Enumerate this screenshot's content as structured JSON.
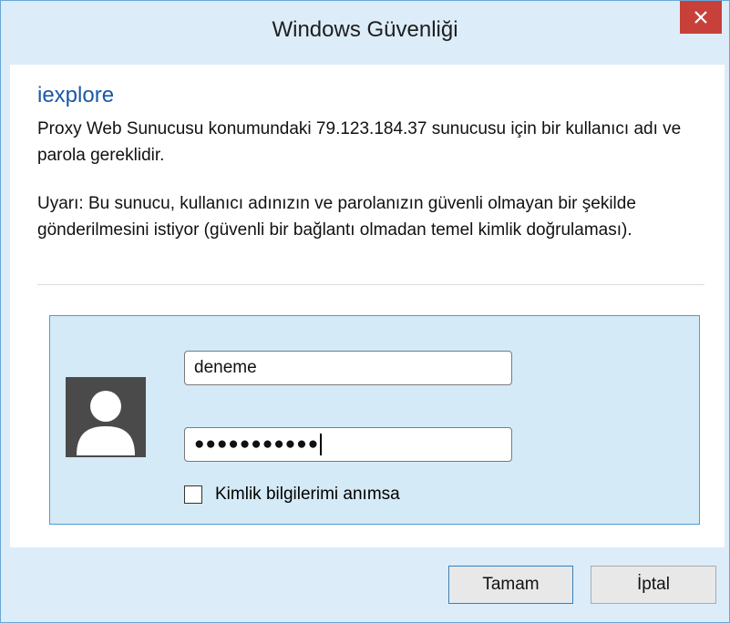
{
  "window": {
    "title": "Windows Güvenliği",
    "close_icon": "close-icon"
  },
  "dialog": {
    "app_name": "iexplore",
    "message": "Proxy Web Sunucusu konumundaki 79.123.184.37 sunucusu için bir kullanıcı adı ve parola gereklidir.",
    "warning": "Uyarı: Bu sunucu, kullanıcı adınızın ve parolanızın güvenli olmayan bir şekilde gönderilmesini istiyor (güvenli bir bağlantı olmadan temel kimlik doğrulaması)."
  },
  "credentials": {
    "avatar_icon": "user-avatar-icon",
    "username_value": "deneme",
    "password_value": "●●●●●●●●●●●",
    "remember_label": "Kimlik bilgilerimi anımsa",
    "remember_checked": false
  },
  "buttons": {
    "ok_label": "Tamam",
    "cancel_label": "İptal"
  },
  "colors": {
    "frame": "#dcecf9",
    "close_button": "#c7413a",
    "app_name": "#1a59a6",
    "credential_panel": "#d4eaf6"
  }
}
